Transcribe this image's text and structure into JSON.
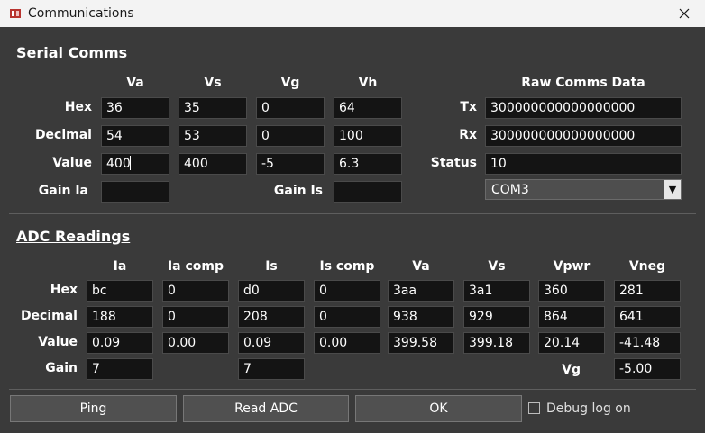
{
  "window": {
    "title": "Communications"
  },
  "serial": {
    "title": "Serial Comms",
    "columns": [
      "Va",
      "Vs",
      "Vg",
      "Vh"
    ],
    "rows": [
      {
        "label": "Hex",
        "values": [
          "36",
          "35",
          "0",
          "64"
        ]
      },
      {
        "label": "Decimal",
        "values": [
          "54",
          "53",
          "0",
          "100"
        ]
      },
      {
        "label": "Value",
        "values": [
          "400",
          "400",
          "-5",
          "6.3"
        ]
      }
    ],
    "gain_ia": {
      "label": "Gain Ia",
      "value": ""
    },
    "gain_is": {
      "label": "Gain Is",
      "value": ""
    },
    "raw": {
      "header": "Raw Comms Data",
      "tx_label": "Tx",
      "tx": "300000000000000000",
      "rx_label": "Rx",
      "rx": "300000000000000000",
      "status_label": "Status",
      "status": "10",
      "port": "COM3"
    }
  },
  "adc": {
    "title": "ADC Readings",
    "columns": [
      "Ia",
      "Ia comp",
      "Is",
      "Is comp",
      "Va",
      "Vs",
      "Vpwr",
      "Vneg"
    ],
    "rows": [
      {
        "label": "Hex",
        "values": [
          "bc",
          "0",
          "d0",
          "0",
          "3aa",
          "3a1",
          "360",
          "281"
        ]
      },
      {
        "label": "Decimal",
        "values": [
          "188",
          "0",
          "208",
          "0",
          "938",
          "929",
          "864",
          "641"
        ]
      },
      {
        "label": "Value",
        "values": [
          "0.09",
          "0.00",
          "0.09",
          "0.00",
          "399.58",
          "399.18",
          "20.14",
          "-41.48"
        ]
      }
    ],
    "gain_label": "Gain",
    "gain_ia": "7",
    "gain_is": "7",
    "vg_label": "Vg",
    "vg": "-5.00"
  },
  "buttons": {
    "ping": "Ping",
    "read_adc": "Read ADC",
    "ok": "OK"
  },
  "debug": {
    "label": "Debug log on",
    "checked": false
  }
}
